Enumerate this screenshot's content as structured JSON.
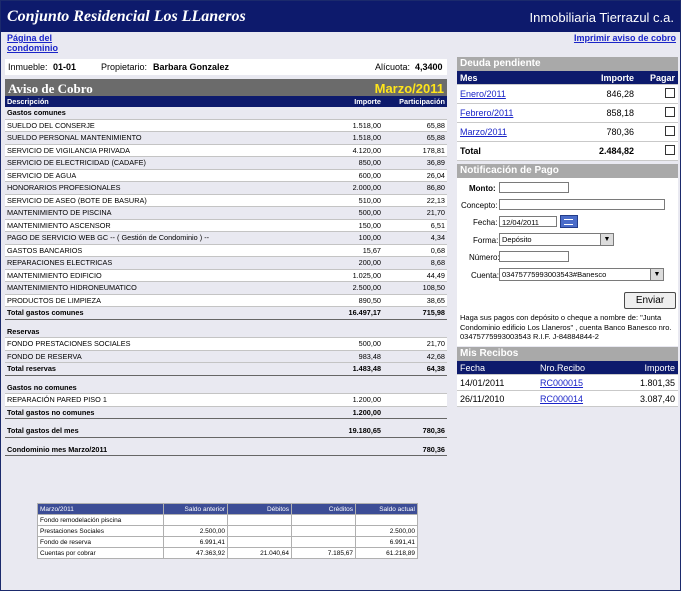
{
  "header": {
    "title": "Conjunto Residencial Los LLaneros",
    "company": "Inmobiliaria Tierrazul c.a."
  },
  "links": {
    "home": "Página del condominio",
    "print": "Imprimir aviso de cobro"
  },
  "inmueble": {
    "label": "Inmueble:",
    "value": "01-01",
    "owner_label": "Propietario:",
    "owner": "Barbara Gonzalez",
    "alicuota_label": "Alícuota:",
    "alicuota": "4,3400"
  },
  "aviso": {
    "title": "Aviso de Cobro",
    "month": "Marzo/2011",
    "columns": [
      "Descripción",
      "Importe",
      "Participación"
    ],
    "gastos_comunes_title": "Gastos comunes",
    "gastos_comunes": [
      {
        "desc": "SUELDO DEL CONSERJE",
        "importe": "1.518,00",
        "part": "65,88"
      },
      {
        "desc": "SUELDO PERSONAL MANTENIMIENTO",
        "importe": "1.518,00",
        "part": "65,88"
      },
      {
        "desc": "SERVICIO DE VIGILANCIA PRIVADA",
        "importe": "4.120,00",
        "part": "178,81"
      },
      {
        "desc": "SERVICIO DE ELECTRICIDAD (CADAFE)",
        "importe": "850,00",
        "part": "36,89"
      },
      {
        "desc": "SERVICIO DE AGUA",
        "importe": "600,00",
        "part": "26,04"
      },
      {
        "desc": "HONORARIOS PROFESIONALES",
        "importe": "2.000,00",
        "part": "86,80"
      },
      {
        "desc": "SERVICIO DE ASEO (BOTE DE BASURA)",
        "importe": "510,00",
        "part": "22,13"
      },
      {
        "desc": "MANTENIMIENTO DE PISCINA",
        "importe": "500,00",
        "part": "21,70"
      },
      {
        "desc": "MANTENIMIENTO ASCENSOR",
        "importe": "150,00",
        "part": "6,51"
      },
      {
        "desc": "PAGO DE SERVICIO WEB GC -- ( Gestión de Condominio ) --",
        "importe": "100,00",
        "part": "4,34"
      },
      {
        "desc": "GASTOS BANCARIOS",
        "importe": "15,67",
        "part": "0,68"
      },
      {
        "desc": "REPARACIONES ELECTRICAS",
        "importe": "200,00",
        "part": "8,68"
      },
      {
        "desc": "MANTENIMIENTO EDIFICIO",
        "importe": "1.025,00",
        "part": "44,49"
      },
      {
        "desc": "MANTENIMIENTO HIDRONEUMATICO",
        "importe": "2.500,00",
        "part": "108,50"
      },
      {
        "desc": "PRODUCTOS DE LIMPIEZA",
        "importe": "890,50",
        "part": "38,65"
      }
    ],
    "total_comunes": {
      "label": "Total gastos comunes",
      "importe": "16.497,17",
      "part": "715,98"
    },
    "reservas_title": "Reservas",
    "reservas": [
      {
        "desc": "FONDO PRESTACIONES SOCIALES",
        "importe": "500,00",
        "part": "21,70"
      },
      {
        "desc": "FONDO DE RESERVA",
        "importe": "983,48",
        "part": "42,68"
      }
    ],
    "total_reservas": {
      "label": "Total reservas",
      "importe": "1.483,48",
      "part": "64,38"
    },
    "no_comunes_title": "Gastos no comunes",
    "no_comunes": [
      {
        "desc": "REPARACIÓN PARED PISO 1",
        "importe": "1.200,00",
        "part": ""
      }
    ],
    "total_no_comunes": {
      "label": "Total gastos no comunes",
      "importe": "1.200,00",
      "part": ""
    },
    "total_mes": {
      "label": "Total gastos del mes",
      "importe": "19.180,65",
      "part": "780,36"
    },
    "condominio_mes": {
      "label": "Condominio mes Marzo/2011",
      "importe": "",
      "part": "780,36"
    }
  },
  "summary": {
    "headers": [
      "Marzo/2011",
      "Saldo anterior",
      "Débitos",
      "Créditos",
      "Saldo actual"
    ],
    "rows": [
      [
        "Fondo remodelación piscina",
        "",
        "",
        "",
        ""
      ],
      [
        "Prestaciones Sociales",
        "2.500,00",
        "",
        "",
        "2.500,00"
      ],
      [
        "Fondo de reserva",
        "6.991,41",
        "",
        "",
        "6.991,41"
      ],
      [
        "Cuentas por cobrar",
        "47.363,92",
        "21.040,64",
        "7.185,67",
        "61.218,89"
      ]
    ]
  },
  "deuda": {
    "title": "Deuda pendiente",
    "headers": [
      "Mes",
      "Importe",
      "Pagar"
    ],
    "rows": [
      {
        "mes": "Enero/2011",
        "importe": "846,28"
      },
      {
        "mes": "Febrero/2011",
        "importe": "858,18"
      },
      {
        "mes": "Marzo/2011",
        "importe": "780,36"
      }
    ],
    "total_label": "Total",
    "total": "2.484,82"
  },
  "pago": {
    "title": "Notificación de Pago",
    "monto_label": "Monto:",
    "concepto_label": "Concepto:",
    "fecha_label": "Fecha:",
    "fecha_value": "12/04/2011",
    "forma_label": "Forma:",
    "forma_value": "Depósito",
    "numero_label": "Número:",
    "cuenta_label": "Cuenta:",
    "cuenta_value": "03475775993003543#Banesco",
    "submit": "Enviar",
    "note": "Haga sus pagos con depósito o cheque a nombre de: \"Junta Condominio edificio Los Llaneros\" , cuenta Banco Banesco nro. 03475775993003543 R.I.F. J-84884844-2"
  },
  "recibos": {
    "title": "Mis Recibos",
    "headers": [
      "Fecha",
      "Nro.Recibo",
      "Importe"
    ],
    "rows": [
      {
        "fecha": "14/01/2011",
        "nro": "RC000015",
        "importe": "1.801,35"
      },
      {
        "fecha": "26/11/2010",
        "nro": "RC000014",
        "importe": "3.087,40"
      }
    ]
  },
  "colors": {
    "navy": "#0d1a6c",
    "gray_header": "#a9a9a9",
    "month_yellow": "#ffe51a",
    "link": "#1a24c8"
  }
}
